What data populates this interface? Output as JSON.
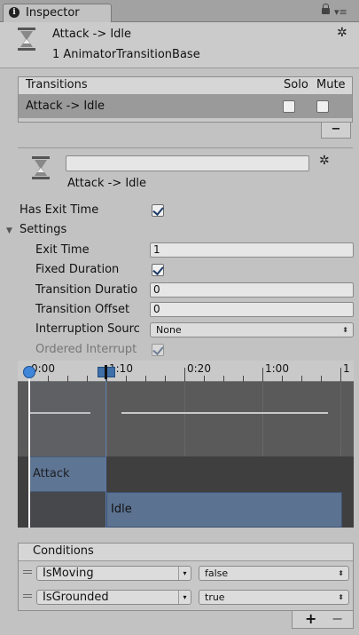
{
  "tab": {
    "label": "Inspector"
  },
  "header": {
    "title": "Attack -> Idle",
    "subtitle": "1 AnimatorTransitionBase"
  },
  "transitions": {
    "header": "Transitions",
    "solo": "Solo",
    "mute": "Mute",
    "rows": [
      {
        "label": "Attack -> Idle",
        "solo": false,
        "mute": false
      }
    ],
    "remove": "−"
  },
  "transition": {
    "name_value": "",
    "title": "Attack -> Idle",
    "has_exit_time_label": "Has Exit Time",
    "has_exit_time": true,
    "settings_label": "Settings",
    "exit_time_label": "Exit Time",
    "exit_time": "1",
    "fixed_duration_label": "Fixed Duration",
    "fixed_duration": true,
    "transition_duration_label": "Transition Duratio",
    "transition_duration": "0",
    "transition_offset_label": "Transition Offset",
    "transition_offset": "0",
    "interruption_source_label": "Interruption Sourc",
    "interruption_source": "None",
    "ordered_interrupt_label": "Ordered Interrupt",
    "ordered_interrupt": true
  },
  "timeline": {
    "ticks": [
      "0:00",
      "1:10",
      "0:20",
      "1:00",
      "1"
    ],
    "source_state": "Attack",
    "dest_state": "Idle"
  },
  "conditions": {
    "header": "Conditions",
    "rows": [
      {
        "param": "IsMoving",
        "value": "false"
      },
      {
        "param": "IsGrounded",
        "value": "true"
      }
    ],
    "add": "+",
    "remove": "−"
  },
  "icons": [
    "info-icon",
    "lock-icon",
    "menu-icon",
    "hourglass-icon",
    "gear-icon",
    "foldout-arrow-icon",
    "drag-handle-icon",
    "dropdown-arrow-icon"
  ]
}
